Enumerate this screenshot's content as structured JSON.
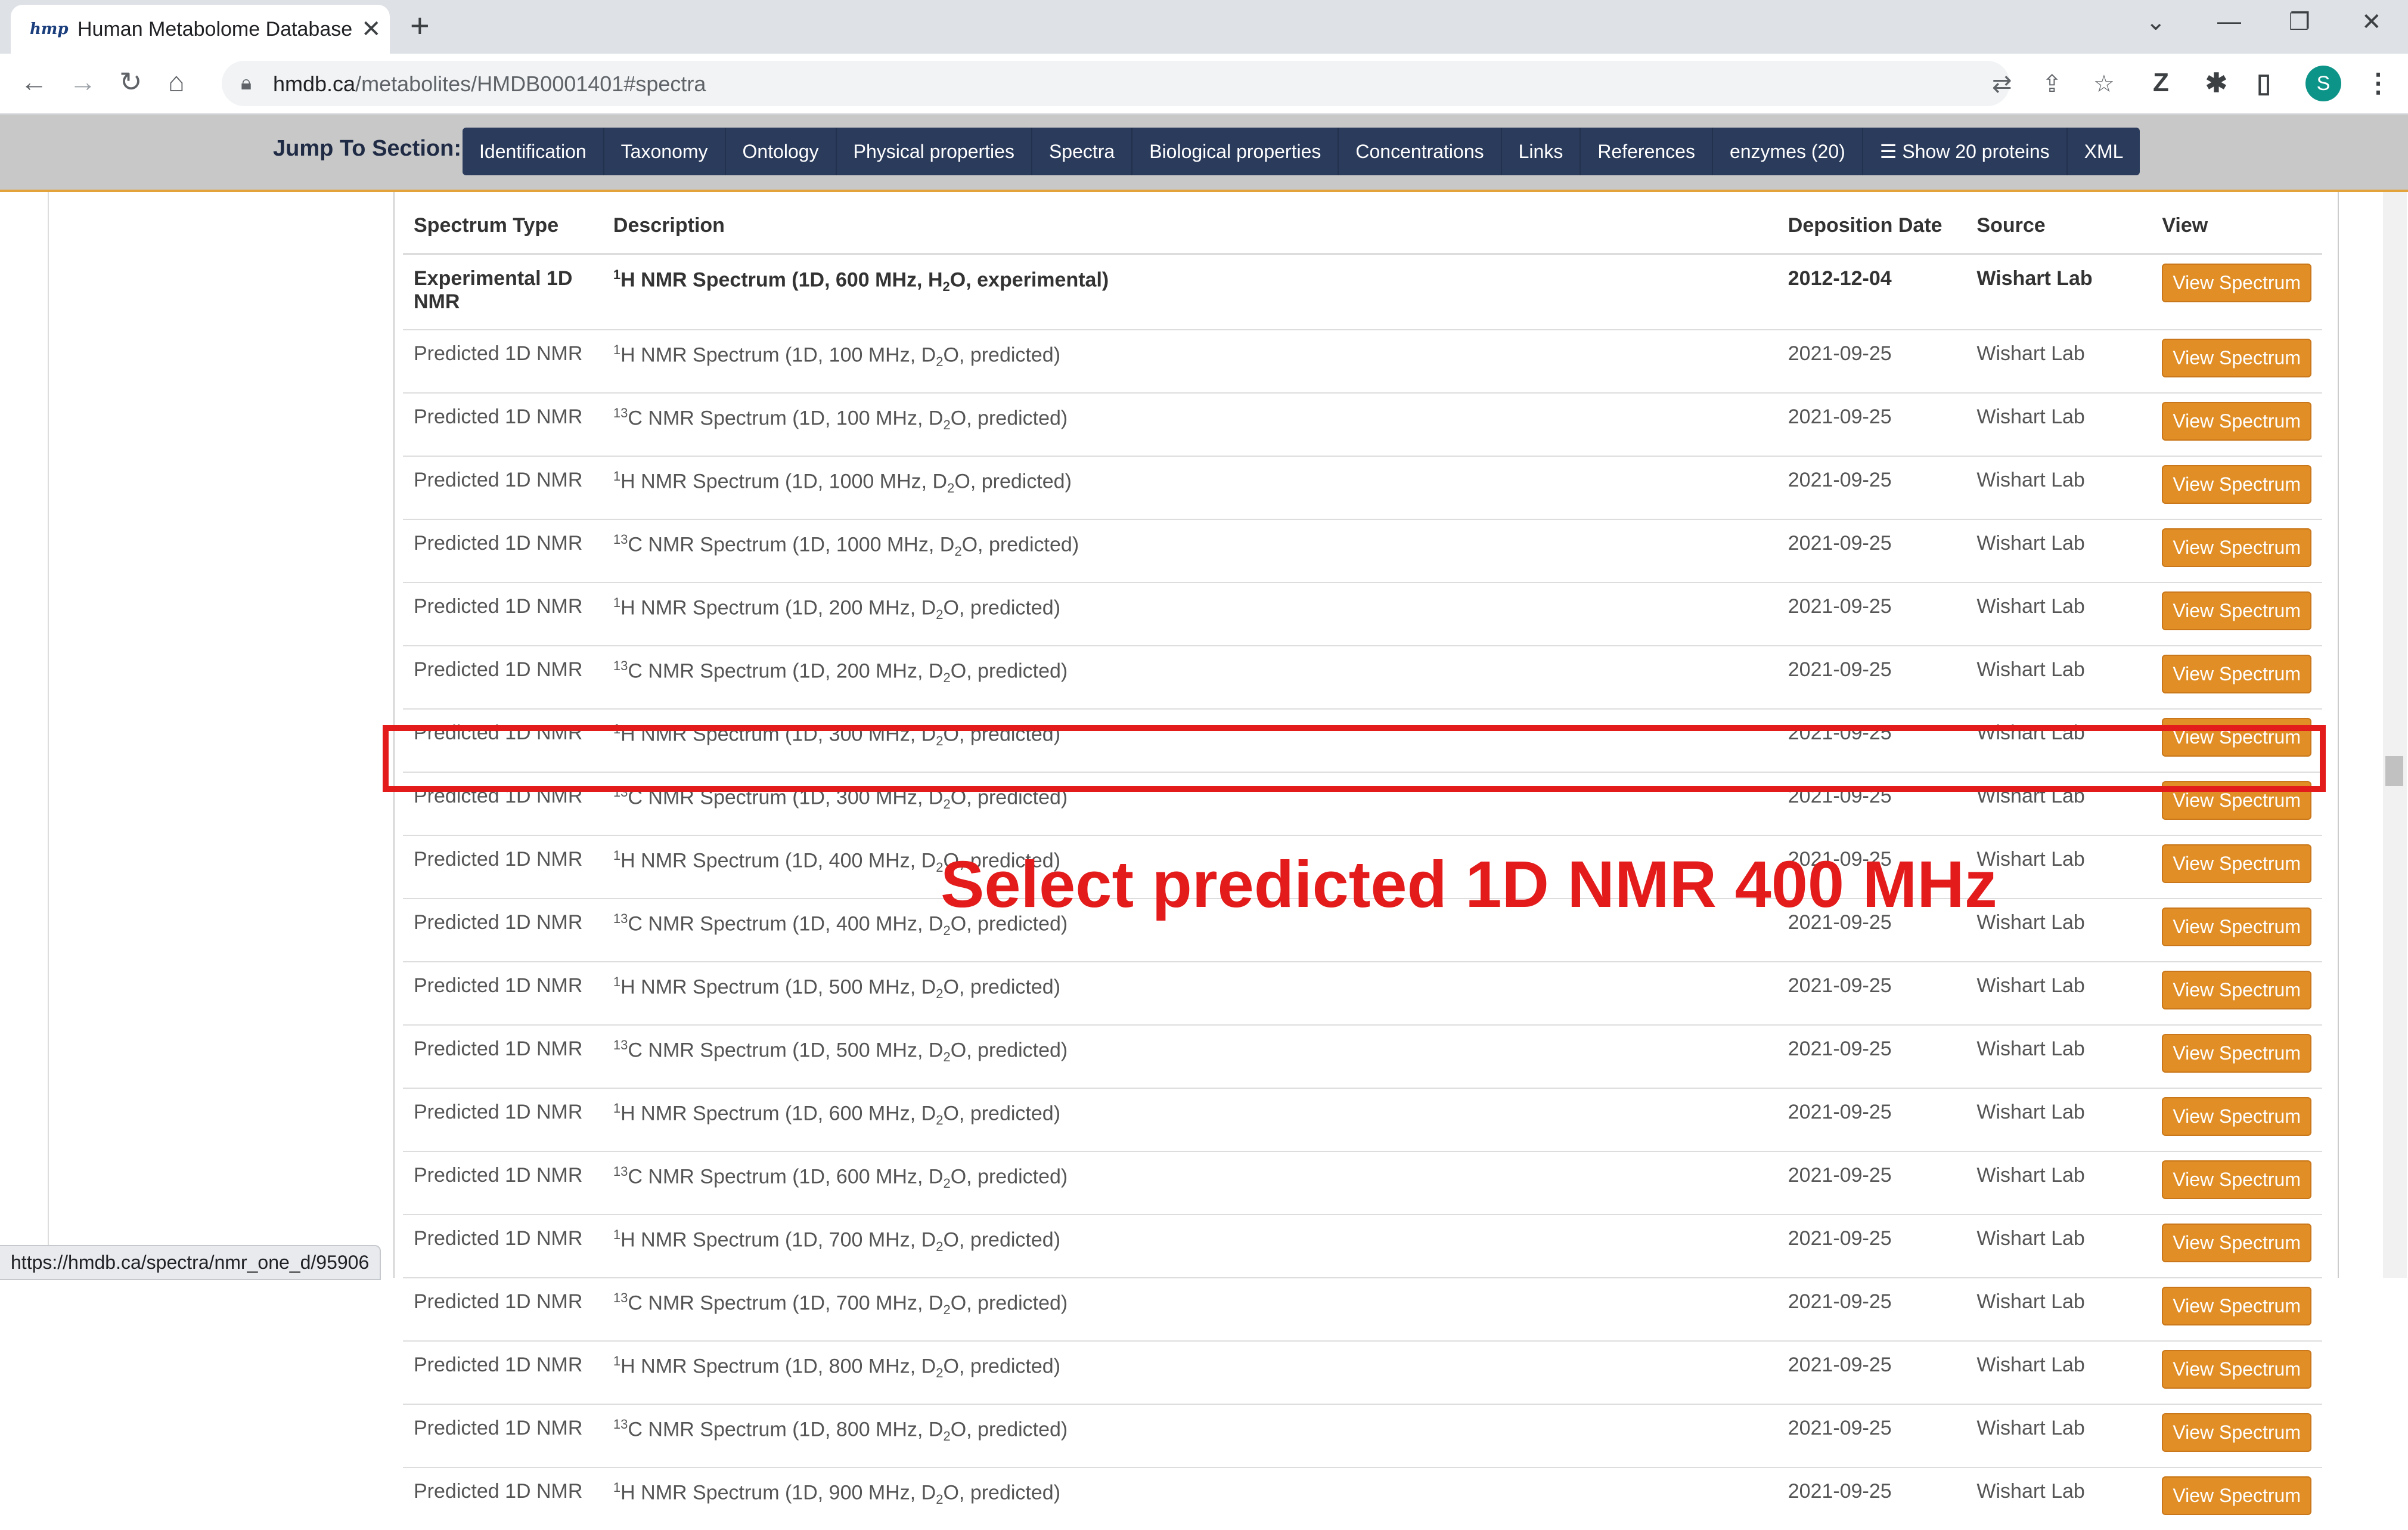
{
  "browser": {
    "tab_title": "Human Metabolome Database: Show",
    "tab_favicon": "hmp",
    "url_domain": "hmdb.ca",
    "url_path": "/metabolites/HMDB0001401#spectra",
    "profile_initial": "S",
    "status_url": "https://hmdb.ca/spectra/nmr_one_d/95906"
  },
  "jump": {
    "label": "Jump To Section:",
    "links": [
      "Identification",
      "Taxonomy",
      "Ontology",
      "Physical properties",
      "Spectra",
      "Biological properties",
      "Concentrations",
      "Links",
      "References",
      "enzymes (20)",
      "Show 20 proteins",
      "XML"
    ]
  },
  "table": {
    "headers": [
      "Spectrum Type",
      "Description",
      "Deposition Date",
      "Source",
      "View"
    ],
    "view_button_label": "View Spectrum",
    "rows": [
      {
        "type": "Experimental 1D NMR",
        "iso": "1",
        "nucleus": "H",
        "freq": "600 MHz",
        "solvent": "H",
        "solvent_sub": "2",
        "solvent_end": "O",
        "mode": "experimental",
        "date": "2012-12-04",
        "source": "Wishart Lab"
      },
      {
        "type": "Predicted 1D NMR",
        "iso": "1",
        "nucleus": "H",
        "freq": "100 MHz",
        "solvent": "D",
        "solvent_sub": "2",
        "solvent_end": "O",
        "mode": "predicted",
        "date": "2021-09-25",
        "source": "Wishart Lab"
      },
      {
        "type": "Predicted 1D NMR",
        "iso": "13",
        "nucleus": "C",
        "freq": "100 MHz",
        "solvent": "D",
        "solvent_sub": "2",
        "solvent_end": "O",
        "mode": "predicted",
        "date": "2021-09-25",
        "source": "Wishart Lab"
      },
      {
        "type": "Predicted 1D NMR",
        "iso": "1",
        "nucleus": "H",
        "freq": "1000 MHz",
        "solvent": "D",
        "solvent_sub": "2",
        "solvent_end": "O",
        "mode": "predicted",
        "date": "2021-09-25",
        "source": "Wishart Lab"
      },
      {
        "type": "Predicted 1D NMR",
        "iso": "13",
        "nucleus": "C",
        "freq": "1000 MHz",
        "solvent": "D",
        "solvent_sub": "2",
        "solvent_end": "O",
        "mode": "predicted",
        "date": "2021-09-25",
        "source": "Wishart Lab"
      },
      {
        "type": "Predicted 1D NMR",
        "iso": "1",
        "nucleus": "H",
        "freq": "200 MHz",
        "solvent": "D",
        "solvent_sub": "2",
        "solvent_end": "O",
        "mode": "predicted",
        "date": "2021-09-25",
        "source": "Wishart Lab"
      },
      {
        "type": "Predicted 1D NMR",
        "iso": "13",
        "nucleus": "C",
        "freq": "200 MHz",
        "solvent": "D",
        "solvent_sub": "2",
        "solvent_end": "O",
        "mode": "predicted",
        "date": "2021-09-25",
        "source": "Wishart Lab"
      },
      {
        "type": "Predicted 1D NMR",
        "iso": "1",
        "nucleus": "H",
        "freq": "300 MHz",
        "solvent": "D",
        "solvent_sub": "2",
        "solvent_end": "O",
        "mode": "predicted",
        "date": "2021-09-25",
        "source": "Wishart Lab"
      },
      {
        "type": "Predicted 1D NMR",
        "iso": "13",
        "nucleus": "C",
        "freq": "300 MHz",
        "solvent": "D",
        "solvent_sub": "2",
        "solvent_end": "O",
        "mode": "predicted",
        "date": "2021-09-25",
        "source": "Wishart Lab"
      },
      {
        "type": "Predicted 1D NMR",
        "iso": "1",
        "nucleus": "H",
        "freq": "400 MHz",
        "solvent": "D",
        "solvent_sub": "2",
        "solvent_end": "O",
        "mode": "predicted",
        "date": "2021-09-25",
        "source": "Wishart Lab"
      },
      {
        "type": "Predicted 1D NMR",
        "iso": "13",
        "nucleus": "C",
        "freq": "400 MHz",
        "solvent": "D",
        "solvent_sub": "2",
        "solvent_end": "O",
        "mode": "predicted",
        "date": "2021-09-25",
        "source": "Wishart Lab"
      },
      {
        "type": "Predicted 1D NMR",
        "iso": "1",
        "nucleus": "H",
        "freq": "500 MHz",
        "solvent": "D",
        "solvent_sub": "2",
        "solvent_end": "O",
        "mode": "predicted",
        "date": "2021-09-25",
        "source": "Wishart Lab"
      },
      {
        "type": "Predicted 1D NMR",
        "iso": "13",
        "nucleus": "C",
        "freq": "500 MHz",
        "solvent": "D",
        "solvent_sub": "2",
        "solvent_end": "O",
        "mode": "predicted",
        "date": "2021-09-25",
        "source": "Wishart Lab"
      },
      {
        "type": "Predicted 1D NMR",
        "iso": "1",
        "nucleus": "H",
        "freq": "600 MHz",
        "solvent": "D",
        "solvent_sub": "2",
        "solvent_end": "O",
        "mode": "predicted",
        "date": "2021-09-25",
        "source": "Wishart Lab"
      },
      {
        "type": "Predicted 1D NMR",
        "iso": "13",
        "nucleus": "C",
        "freq": "600 MHz",
        "solvent": "D",
        "solvent_sub": "2",
        "solvent_end": "O",
        "mode": "predicted",
        "date": "2021-09-25",
        "source": "Wishart Lab"
      },
      {
        "type": "Predicted 1D NMR",
        "iso": "1",
        "nucleus": "H",
        "freq": "700 MHz",
        "solvent": "D",
        "solvent_sub": "2",
        "solvent_end": "O",
        "mode": "predicted",
        "date": "2021-09-25",
        "source": "Wishart Lab"
      },
      {
        "type": "Predicted 1D NMR",
        "iso": "13",
        "nucleus": "C",
        "freq": "700 MHz",
        "solvent": "D",
        "solvent_sub": "2",
        "solvent_end": "O",
        "mode": "predicted",
        "date": "2021-09-25",
        "source": "Wishart Lab"
      },
      {
        "type": "Predicted 1D NMR",
        "iso": "1",
        "nucleus": "H",
        "freq": "800 MHz",
        "solvent": "D",
        "solvent_sub": "2",
        "solvent_end": "O",
        "mode": "predicted",
        "date": "2021-09-25",
        "source": "Wishart Lab"
      },
      {
        "type": "Predicted 1D NMR",
        "iso": "13",
        "nucleus": "C",
        "freq": "800 MHz",
        "solvent": "D",
        "solvent_sub": "2",
        "solvent_end": "O",
        "mode": "predicted",
        "date": "2021-09-25",
        "source": "Wishart Lab"
      },
      {
        "type": "Predicted 1D NMR",
        "iso": "1",
        "nucleus": "H",
        "freq": "900 MHz",
        "solvent": "D",
        "solvent_sub": "2",
        "solvent_end": "O",
        "mode": "predicted",
        "date": "2021-09-25",
        "source": "Wishart Lab"
      }
    ]
  },
  "annotation": {
    "instruction": "Select  predicted 1D NMR 400 MHz",
    "highlight_color": "#e31b1b"
  },
  "colors": {
    "jump_bar_bg": "#2b3b5c",
    "button_orange": "#e08e25"
  }
}
